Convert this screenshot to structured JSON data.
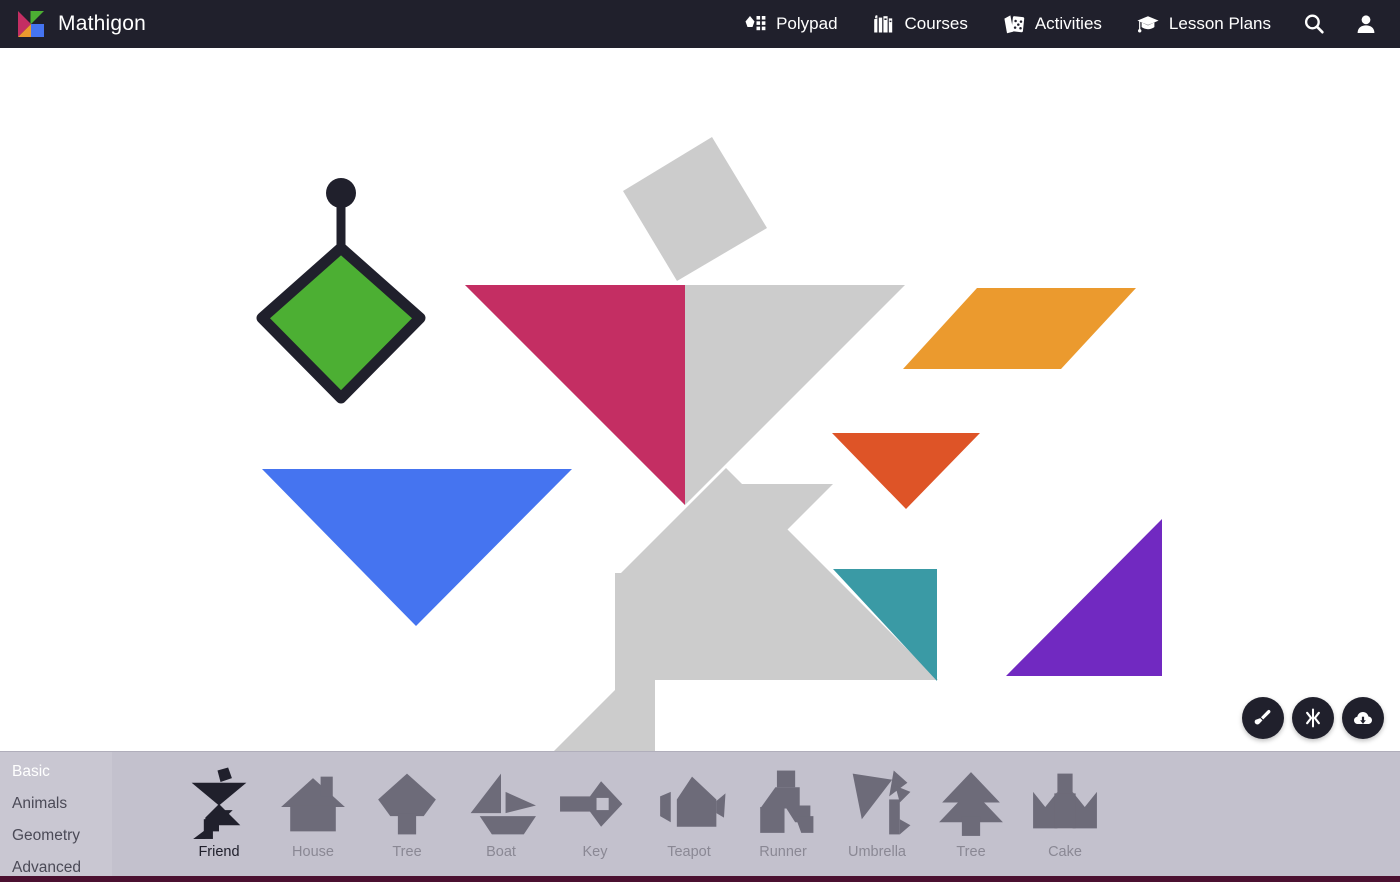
{
  "navbar": {
    "brand": "Mathigon",
    "brand_logo_icon": "mathigon-logo-icon",
    "items": [
      {
        "label": "Polypad",
        "icon": "polypad-icon"
      },
      {
        "label": "Courses",
        "icon": "courses-icon"
      },
      {
        "label": "Activities",
        "icon": "activities-icon"
      },
      {
        "label": "Lesson Plans",
        "icon": "lesson-plans-icon"
      }
    ],
    "search_icon": "search-icon",
    "account_icon": "user-account-icon"
  },
  "canvas": {
    "background_color": "#ffffff",
    "silhouette_color": "#cccccc",
    "selection_color": "#20202c",
    "pieces": [
      {
        "name": "square",
        "label": "Green Square",
        "color": "#4caf33",
        "selected": true
      },
      {
        "name": "large-triangle-1",
        "label": "Crimson Triangle",
        "color": "#c42e63",
        "selected": false
      },
      {
        "name": "large-triangle-2",
        "label": "Blue Triangle",
        "color": "#4574f0",
        "selected": false
      },
      {
        "name": "parallelogram",
        "label": "Orange Parallelogram",
        "color": "#eb9a2e",
        "selected": false
      },
      {
        "name": "medium-triangle",
        "label": "Red Triangle",
        "color": "#de5427",
        "selected": false
      },
      {
        "name": "small-triangle-1",
        "label": "Teal Triangle",
        "color": "#3a9aa5",
        "selected": false
      },
      {
        "name": "small-triangle-2",
        "label": "Purple Triangle",
        "color": "#7129c1",
        "selected": false
      }
    ]
  },
  "fabs": [
    {
      "name": "paintbrush-button",
      "icon": "paintbrush-icon",
      "title": "Colour"
    },
    {
      "name": "mirror-button",
      "icon": "mirror-icon",
      "title": "Flip"
    },
    {
      "name": "download-button",
      "icon": "cloud-download-icon",
      "title": "Download"
    }
  ],
  "gallery": {
    "categories": [
      {
        "label": "Basic",
        "active": true
      },
      {
        "label": "Animals",
        "active": false
      },
      {
        "label": "Geometry",
        "active": false
      },
      {
        "label": "Advanced",
        "active": false
      }
    ],
    "tiles": [
      {
        "label": "Friend",
        "icon": "tangram-friend-icon",
        "active": true
      },
      {
        "label": "House",
        "icon": "tangram-house-icon",
        "active": false
      },
      {
        "label": "Tree",
        "icon": "tangram-tree-icon",
        "active": false
      },
      {
        "label": "Boat",
        "icon": "tangram-boat-icon",
        "active": false
      },
      {
        "label": "Key",
        "icon": "tangram-key-icon",
        "active": false
      },
      {
        "label": "Teapot",
        "icon": "tangram-teapot-icon",
        "active": false
      },
      {
        "label": "Runner",
        "icon": "tangram-runner-icon",
        "active": false
      },
      {
        "label": "Umbrella",
        "icon": "tangram-umbrella-icon",
        "active": false
      },
      {
        "label": "Tree",
        "icon": "tangram-tree2-icon",
        "active": false
      },
      {
        "label": "Cake",
        "icon": "tangram-cake-icon",
        "active": false
      }
    ]
  },
  "theme": {
    "navbar_bg": "#20202c",
    "gallery_bg": "#c3c1cd",
    "rail_bg": "#c9c7d2",
    "active_tab_bg": "#3b3a48",
    "bottom_strip": "#4b1030"
  }
}
